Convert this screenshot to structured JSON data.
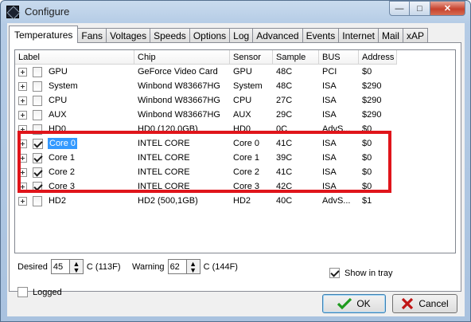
{
  "window": {
    "title": "Configure"
  },
  "caption": {
    "minimize": "—",
    "maximize": "□",
    "close": "✕"
  },
  "tabs": [
    {
      "label": "Temperatures",
      "active": true
    },
    {
      "label": "Fans"
    },
    {
      "label": "Voltages"
    },
    {
      "label": "Speeds"
    },
    {
      "label": "Options"
    },
    {
      "label": "Log"
    },
    {
      "label": "Advanced"
    },
    {
      "label": "Events"
    },
    {
      "label": "Internet"
    },
    {
      "label": "Mail"
    },
    {
      "label": "xAP"
    }
  ],
  "table": {
    "columns": [
      "Label",
      "Chip",
      "Sensor",
      "Sample",
      "BUS",
      "Address"
    ],
    "rows": [
      {
        "label": "GPU",
        "checked": false,
        "chip": "GeForce Video Card",
        "sensor": "GPU",
        "sample": "48C",
        "bus": "PCI",
        "address": "$0"
      },
      {
        "label": "System",
        "checked": false,
        "chip": "Winbond W83667HG",
        "sensor": "System",
        "sample": "48C",
        "bus": "ISA",
        "address": "$290"
      },
      {
        "label": "CPU",
        "checked": false,
        "chip": "Winbond W83667HG",
        "sensor": "CPU",
        "sample": "27C",
        "bus": "ISA",
        "address": "$290"
      },
      {
        "label": "AUX",
        "checked": false,
        "chip": "Winbond W83667HG",
        "sensor": "AUX",
        "sample": "29C",
        "bus": "ISA",
        "address": "$290"
      },
      {
        "label": "HD0",
        "checked": false,
        "chip": "HD0 (120,0GB)",
        "sensor": "HD0",
        "sample": "0C",
        "bus": "AdvS...",
        "address": "$0"
      },
      {
        "label": "Core 0",
        "checked": true,
        "selected": true,
        "chip": "INTEL CORE",
        "sensor": "Core 0",
        "sample": "41C",
        "bus": "ISA",
        "address": "$0"
      },
      {
        "label": "Core 1",
        "checked": true,
        "chip": "INTEL CORE",
        "sensor": "Core 1",
        "sample": "39C",
        "bus": "ISA",
        "address": "$0"
      },
      {
        "label": "Core 2",
        "checked": true,
        "chip": "INTEL CORE",
        "sensor": "Core 2",
        "sample": "41C",
        "bus": "ISA",
        "address": "$0"
      },
      {
        "label": "Core 3",
        "checked": true,
        "chip": "INTEL CORE",
        "sensor": "Core 3",
        "sample": "42C",
        "bus": "ISA",
        "address": "$0"
      },
      {
        "label": "HD2",
        "checked": false,
        "chip": "HD2 (500,1GB)",
        "sensor": "HD2",
        "sample": "40C",
        "bus": "AdvS...",
        "address": "$1"
      }
    ]
  },
  "settings": {
    "desired_label": "Desired",
    "desired_value": "45",
    "desired_unit": "C (113F)",
    "warning_label": "Warning",
    "warning_value": "62",
    "warning_unit": "C (144F)",
    "show_in_tray_label": "Show in tray",
    "show_in_tray_checked": true,
    "logged_label": "Logged",
    "logged_checked": false
  },
  "buttons": {
    "ok": "OK",
    "cancel": "Cancel"
  },
  "colors": {
    "highlight": "#e0151b",
    "selection": "#3399ff",
    "ok_check": "#1e9a1e",
    "cancel_x": "#c01616"
  }
}
